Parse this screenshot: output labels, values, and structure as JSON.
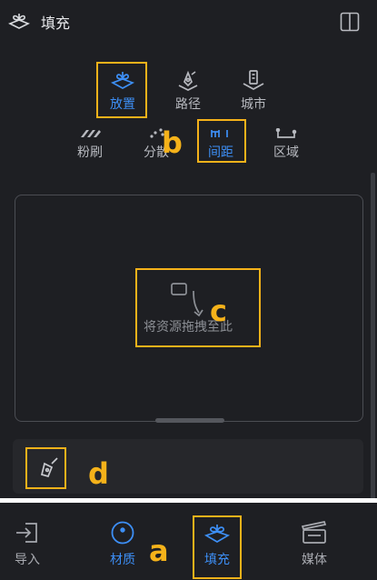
{
  "header": {
    "title": "填充",
    "app_icon": "fill-tool-icon",
    "toggle_icon": "panel-split-icon"
  },
  "modes_row1": [
    {
      "label": "放置",
      "icon": "place-icon",
      "active": true
    },
    {
      "label": "路径",
      "icon": "path-pen-icon",
      "active": false
    },
    {
      "label": "城市",
      "icon": "city-icon",
      "active": false
    }
  ],
  "modes_row2": [
    {
      "label": "粉刷",
      "icon": "brush-icon",
      "active": false
    },
    {
      "label": "分散",
      "icon": "scatter-icon",
      "active": false
    },
    {
      "label": "间距",
      "icon": "spacing-icon",
      "active": true
    },
    {
      "label": "区域",
      "icon": "region-icon",
      "active": false
    }
  ],
  "dropzone": {
    "text": "将资源拖拽至此",
    "icon": "drag-drop-icon"
  },
  "tool_panel": {
    "icon": "pen-tool-icon"
  },
  "bottom_nav": [
    {
      "label": "导入",
      "icon": "import-icon",
      "active": false
    },
    {
      "label": "材质",
      "icon": "material-icon",
      "active": true
    },
    {
      "label": "填充",
      "icon": "fill-tool-icon",
      "active": true
    },
    {
      "label": "媒体",
      "icon": "media-clapper-icon",
      "active": false
    }
  ],
  "annotations": {
    "a": "a",
    "b": "b",
    "c": "c",
    "d": "d"
  },
  "colors": {
    "accent": "#3d8ff6",
    "highlight": "#f5b21a",
    "background": "#1e1f23"
  }
}
